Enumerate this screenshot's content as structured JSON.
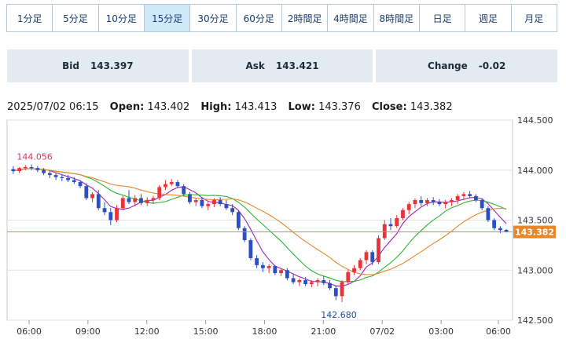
{
  "tabs": [
    "1分足",
    "5分足",
    "10分足",
    "15分足",
    "30分足",
    "60分足",
    "2時間足",
    "4時間足",
    "8時間足",
    "日足",
    "週足",
    "月足"
  ],
  "active_tab": "15分足",
  "quotes": {
    "bid_label": "Bid",
    "bid_value": "143.397",
    "ask_label": "Ask",
    "ask_value": "143.421",
    "change_label": "Change",
    "change_value": "-0.02"
  },
  "ohlc": {
    "datetime": "2025/07/02 06:15",
    "open_label": "Open:",
    "open": "143.402",
    "high_label": "High:",
    "high": "143.413",
    "low_label": "Low:",
    "low": "143.376",
    "close_label": "Close:",
    "close": "143.382"
  },
  "colors": {
    "up": "#e8333b",
    "down": "#2a4fc6",
    "ma_fast": "#a020c0",
    "ma_mid": "#2ab82a",
    "ma_slow": "#e8862a",
    "price_line": "#e8862a",
    "annotation_high": "#d8375a",
    "annotation_low": "#1a4f9a"
  },
  "chart_data": {
    "type": "candlestick",
    "y_ticks": [
      "144.500",
      "144.000",
      "143.500",
      "143.000",
      "142.500"
    ],
    "ylim": [
      142.5,
      144.5
    ],
    "x_ticks": [
      "06:00",
      "09:00",
      "12:00",
      "15:00",
      "18:00",
      "21:00",
      "07/02",
      "03:00",
      "06:00"
    ],
    "annotations": {
      "high": "144.056",
      "low": "142.680"
    },
    "current_price": "143.382",
    "candles_ohlc": [
      [
        144.01,
        144.04,
        143.96,
        143.99
      ],
      [
        143.99,
        144.03,
        143.97,
        144.02
      ],
      [
        144.02,
        144.05,
        144.0,
        144.03
      ],
      [
        144.03,
        144.056,
        144.0,
        144.02
      ],
      [
        144.02,
        144.04,
        143.98,
        144.0
      ],
      [
        144.0,
        144.02,
        143.95,
        143.97
      ],
      [
        143.97,
        144.0,
        143.92,
        143.95
      ],
      [
        143.95,
        143.97,
        143.9,
        143.93
      ],
      [
        143.93,
        143.96,
        143.89,
        143.92
      ],
      [
        143.92,
        143.95,
        143.88,
        143.9
      ],
      [
        143.9,
        143.93,
        143.86,
        143.88
      ],
      [
        143.88,
        143.9,
        143.82,
        143.84
      ],
      [
        143.84,
        143.87,
        143.7,
        143.72
      ],
      [
        143.72,
        143.78,
        143.68,
        143.76
      ],
      [
        143.76,
        143.8,
        143.6,
        143.62
      ],
      [
        143.62,
        143.68,
        143.55,
        143.58
      ],
      [
        143.58,
        143.62,
        143.45,
        143.5
      ],
      [
        143.5,
        143.65,
        143.48,
        143.62
      ],
      [
        143.62,
        143.74,
        143.6,
        143.72
      ],
      [
        143.72,
        143.8,
        143.66,
        143.68
      ],
      [
        143.68,
        143.75,
        143.64,
        143.72
      ],
      [
        143.72,
        143.76,
        143.65,
        143.67
      ],
      [
        143.67,
        143.73,
        143.64,
        143.7
      ],
      [
        143.7,
        143.74,
        143.66,
        143.72
      ],
      [
        143.72,
        143.85,
        143.7,
        143.83
      ],
      [
        143.83,
        143.9,
        143.8,
        143.86
      ],
      [
        143.86,
        143.91,
        143.84,
        143.88
      ],
      [
        143.88,
        143.9,
        143.82,
        143.84
      ],
      [
        143.84,
        143.86,
        143.74,
        143.76
      ],
      [
        143.76,
        143.78,
        143.66,
        143.68
      ],
      [
        143.68,
        143.72,
        143.64,
        143.7
      ],
      [
        143.7,
        143.73,
        143.62,
        143.64
      ],
      [
        143.64,
        143.68,
        143.6,
        143.66
      ],
      [
        143.66,
        143.72,
        143.63,
        143.7
      ],
      [
        143.7,
        143.73,
        143.64,
        143.66
      ],
      [
        143.66,
        143.7,
        143.6,
        143.62
      ],
      [
        143.62,
        143.66,
        143.55,
        143.58
      ],
      [
        143.58,
        143.6,
        143.4,
        143.42
      ],
      [
        143.42,
        143.44,
        143.28,
        143.3
      ],
      [
        143.3,
        143.32,
        143.1,
        143.12
      ],
      [
        143.12,
        143.15,
        143.02,
        143.05
      ],
      [
        143.05,
        143.08,
        142.98,
        143.02
      ],
      [
        143.02,
        143.06,
        142.97,
        143.04
      ],
      [
        143.04,
        143.05,
        142.95,
        142.97
      ],
      [
        142.97,
        143.02,
        142.94,
        143.0
      ],
      [
        143.0,
        143.02,
        142.9,
        142.92
      ],
      [
        142.92,
        142.96,
        142.86,
        142.88
      ],
      [
        142.88,
        142.92,
        142.84,
        142.9
      ],
      [
        142.9,
        142.93,
        142.84,
        142.86
      ],
      [
        142.86,
        142.9,
        142.83,
        142.88
      ],
      [
        142.88,
        142.92,
        142.84,
        142.9
      ],
      [
        142.9,
        142.94,
        142.85,
        142.87
      ],
      [
        142.87,
        142.9,
        142.8,
        142.82
      ],
      [
        142.82,
        142.85,
        142.7,
        142.74
      ],
      [
        142.74,
        142.9,
        142.68,
        142.88
      ],
      [
        142.88,
        143.0,
        142.86,
        142.98
      ],
      [
        142.98,
        143.05,
        142.95,
        143.02
      ],
      [
        143.02,
        143.12,
        143.0,
        143.1
      ],
      [
        143.1,
        143.2,
        143.06,
        143.18
      ],
      [
        143.18,
        143.2,
        143.05,
        143.08
      ],
      [
        143.08,
        143.35,
        143.06,
        143.32
      ],
      [
        143.32,
        143.5,
        143.3,
        143.46
      ],
      [
        143.46,
        143.52,
        143.4,
        143.44
      ],
      [
        143.44,
        143.55,
        143.42,
        143.52
      ],
      [
        143.52,
        143.62,
        143.5,
        143.6
      ],
      [
        143.6,
        143.68,
        143.56,
        143.66
      ],
      [
        143.66,
        143.72,
        143.62,
        143.7
      ],
      [
        143.7,
        143.74,
        143.64,
        143.67
      ],
      [
        143.67,
        143.72,
        143.64,
        143.7
      ],
      [
        143.7,
        143.73,
        143.65,
        143.68
      ],
      [
        143.68,
        143.71,
        143.64,
        143.66
      ],
      [
        143.66,
        143.7,
        143.62,
        143.68
      ],
      [
        143.68,
        143.72,
        143.64,
        143.7
      ],
      [
        143.7,
        143.76,
        143.66,
        143.74
      ],
      [
        143.74,
        143.78,
        143.7,
        143.76
      ],
      [
        143.76,
        143.79,
        143.72,
        143.74
      ],
      [
        143.74,
        143.76,
        143.68,
        143.7
      ],
      [
        143.7,
        143.72,
        143.6,
        143.62
      ],
      [
        143.62,
        143.64,
        143.48,
        143.5
      ],
      [
        143.5,
        143.52,
        143.4,
        143.42
      ],
      [
        143.42,
        143.44,
        143.37,
        143.4
      ],
      [
        143.402,
        143.413,
        143.376,
        143.382
      ]
    ]
  }
}
